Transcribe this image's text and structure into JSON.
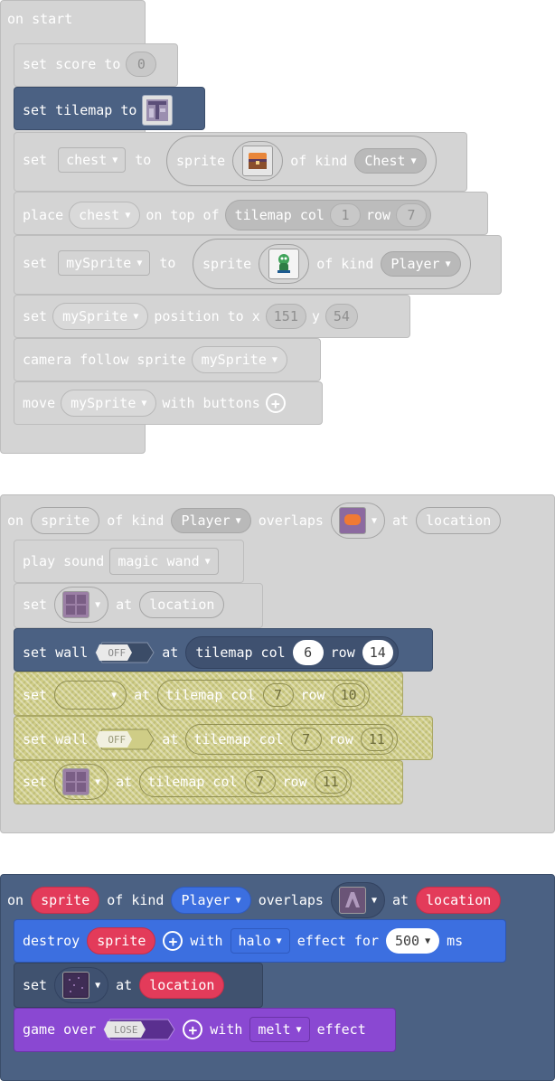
{
  "colors": {
    "gray_block": "#d4d4d4",
    "navy_block": "#4b6183",
    "hatched_block": "#cfcd86",
    "red_pill": "#e33b5a",
    "blue_block": "#3c6fe0",
    "purple_block": "#8a48d2"
  },
  "group1": {
    "hat": "on start",
    "set_score": {
      "label": "set score to",
      "value": "0"
    },
    "set_tilemap": {
      "label": "set tilemap to",
      "icon": "tilemap-thumbnail-icon"
    },
    "set_chest": {
      "set": "set",
      "var": "chest",
      "to": "to",
      "sprite": "sprite",
      "icon": "treasure-chest-icon",
      "of_kind": "of kind",
      "kind": "Chest"
    },
    "place_chest": {
      "place": "place",
      "var": "chest",
      "on_top": "on top of",
      "tilemap_col": "tilemap col",
      "col": "1",
      "row_label": "row",
      "row": "7"
    },
    "set_mysprite": {
      "set": "set",
      "var": "mySprite",
      "to": "to",
      "sprite": "sprite",
      "icon": "green-snake-sprite-icon",
      "of_kind": "of kind",
      "kind": "Player"
    },
    "set_position": {
      "set": "set",
      "var": "mySprite",
      "position": "position to x",
      "x": "151",
      "y_label": "y",
      "y": "54"
    },
    "camera": {
      "label": "camera follow sprite",
      "var": "mySprite"
    },
    "move": {
      "move": "move",
      "var": "mySprite",
      "with": "with buttons"
    }
  },
  "group2": {
    "hat": {
      "on": "on",
      "sprite": "sprite",
      "of_kind": "of kind",
      "kind": "Player",
      "overlaps": "overlaps",
      "icon": "orange-button-tile-icon",
      "at": "at",
      "location": "location"
    },
    "play_sound": {
      "label": "play sound",
      "sound": "magic wand"
    },
    "set_tile": {
      "set": "set",
      "icon": "purple-brick-tile-icon",
      "at": "at",
      "location": "location"
    },
    "set_wall_1": {
      "label": "set wall",
      "toggle": "OFF",
      "at": "at",
      "tilemap_col": "tilemap col",
      "col": "6",
      "row_label": "row",
      "row": "14"
    },
    "set_tile_2": {
      "set": "set",
      "at": "at",
      "tilemap_col": "tilemap col",
      "col": "7",
      "row_label": "row",
      "row": "10"
    },
    "set_wall_2": {
      "label": "set wall",
      "toggle": "OFF",
      "at": "at",
      "tilemap_col": "tilemap col",
      "col": "7",
      "row_label": "row",
      "row": "11"
    },
    "set_tile_3": {
      "set": "set",
      "icon": "purple-brick-tile-icon",
      "at": "at",
      "tilemap_col": "tilemap col",
      "col": "7",
      "row_label": "row",
      "row": "11"
    }
  },
  "group3": {
    "hat": {
      "on": "on",
      "sprite": "sprite",
      "of_kind": "of kind",
      "kind": "Player",
      "overlaps": "overlaps",
      "icon": "purple-stone-tile-icon",
      "at": "at",
      "location": "location"
    },
    "destroy": {
      "label": "destroy",
      "sprite": "sprite",
      "with": "with",
      "effect": "halo",
      "effect_for": "effect for",
      "ms_value": "500",
      "ms": "ms"
    },
    "set_tile": {
      "set": "set",
      "icon": "dark-purple-tile-icon",
      "at": "at",
      "location": "location"
    },
    "game_over": {
      "label": "game over",
      "toggle": "LOSE",
      "with": "with",
      "effect": "melt",
      "effect_label": "effect"
    }
  }
}
